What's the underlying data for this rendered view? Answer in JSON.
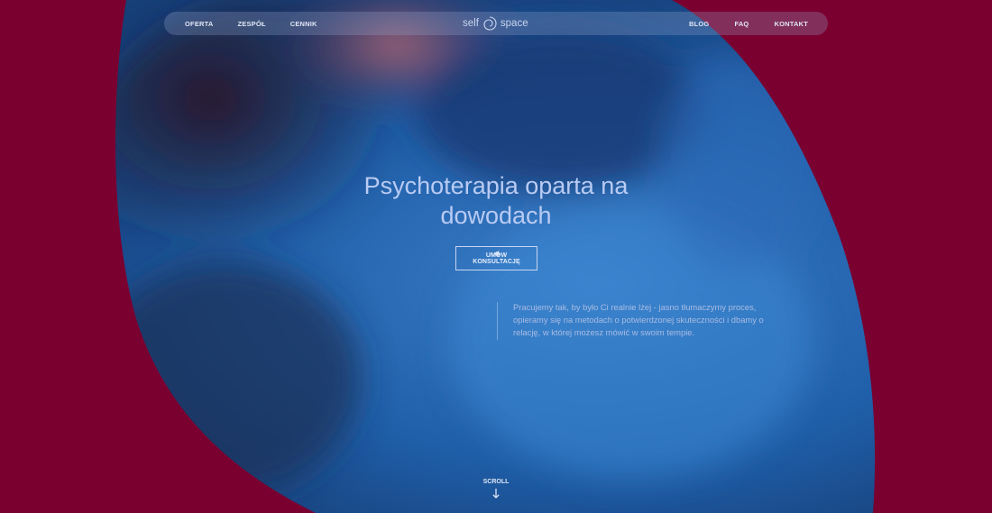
{
  "colors": {
    "background": "#7a0030",
    "accent_text": "#b9cbf3",
    "photo_blue": "#1f5ea8"
  },
  "nav": {
    "left_items": [
      "OFERTA",
      "ZESPÓŁ",
      "CENNIK"
    ],
    "logo_left": "self",
    "logo_right": "space",
    "right_items": [
      "BLOG",
      "FAQ",
      "KONTAKT"
    ]
  },
  "hero": {
    "headline_line1": "Psychoterapia oparta na",
    "headline_line2": "dowodach",
    "cta_label": "UMÓW KONSULTACJĘ",
    "description": "Pracujemy tak, by było Ci realnie lżej - jasno tłumaczymy proces, opieramy się na metodach o potwierdzonej skuteczności i dbamy o relację, w której możesz mówić w swoim tempie.",
    "scroll_label": "SCROLL"
  },
  "icons": {
    "logo_mark": "spiral-icon",
    "scroll": "arrow-down-icon"
  }
}
